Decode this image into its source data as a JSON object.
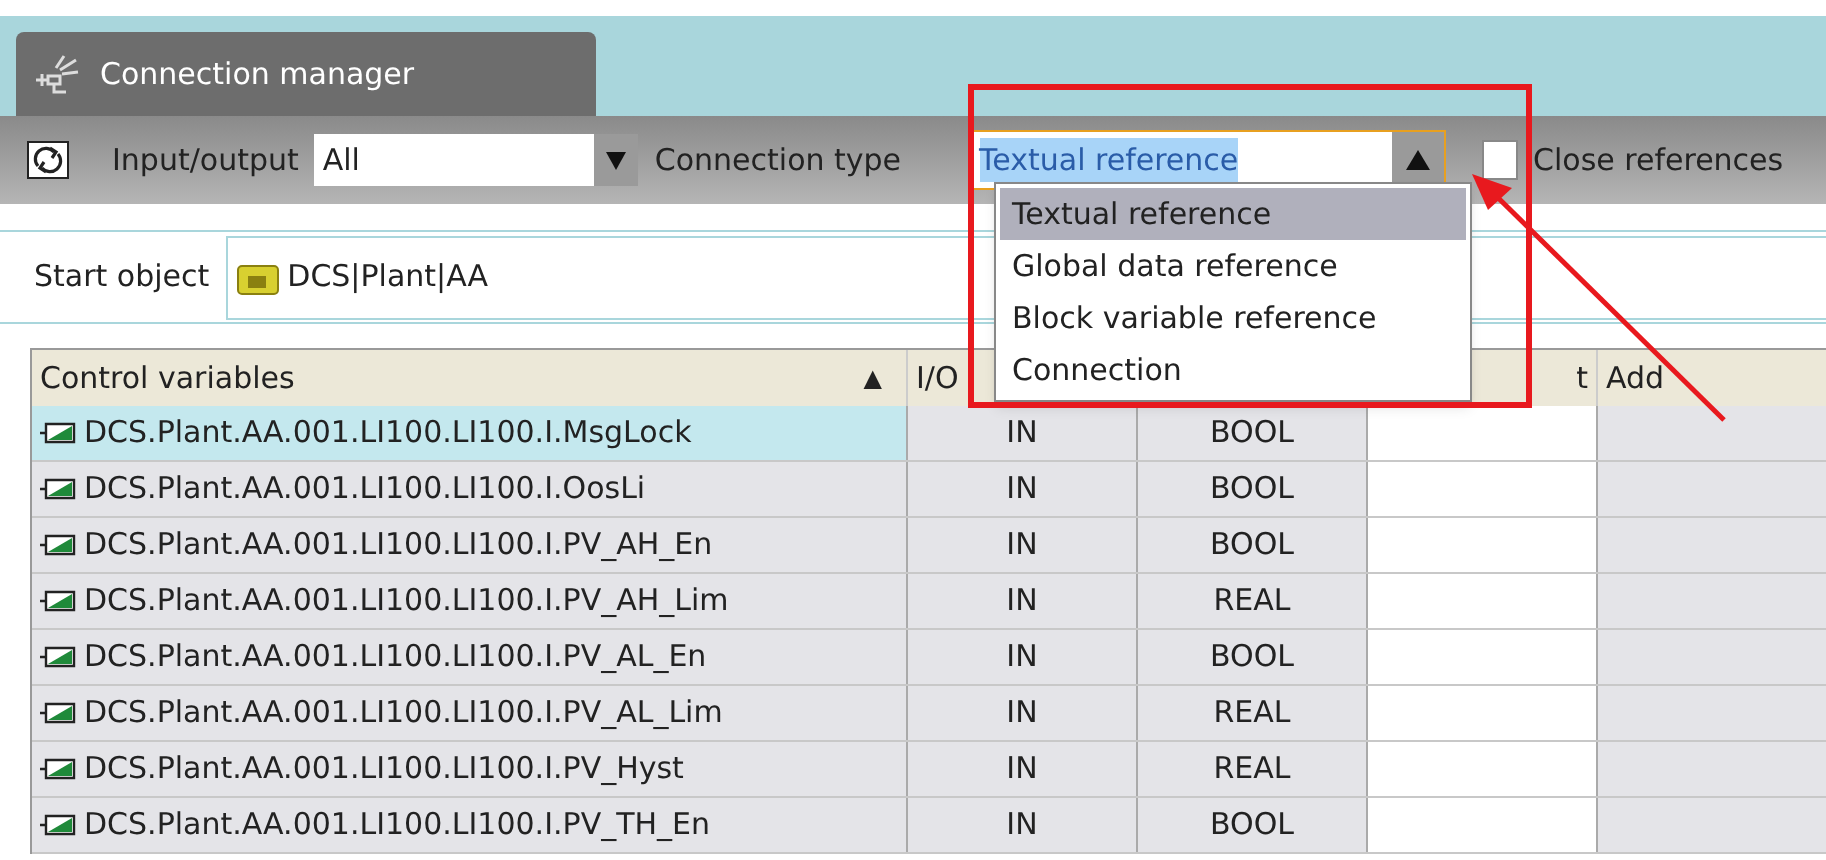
{
  "tab": {
    "title": "Connection manager",
    "selected": true
  },
  "toolbar": {
    "io_label": "Input/output",
    "io_value": "All",
    "type_label": "Connection type",
    "type_value": "Textual reference",
    "close_label": "Close references",
    "close_checked": false
  },
  "dropdown": {
    "options": [
      {
        "label": "Textual reference",
        "selected": true
      },
      {
        "label": "Global data reference",
        "selected": false
      },
      {
        "label": "Block variable reference",
        "selected": false
      },
      {
        "label": "Connection",
        "selected": false
      }
    ]
  },
  "start_object": {
    "label": "Start object",
    "value": "DCS|Plant|AA"
  },
  "table": {
    "columns": [
      "Control variables",
      "I/O",
      "t",
      "Add"
    ],
    "sort_icon": "▲",
    "rows": [
      {
        "name": "DCS.Plant.AA.001.LI100.LI100.I.MsgLock",
        "io": "IN",
        "type": "BOOL",
        "selected": true
      },
      {
        "name": "DCS.Plant.AA.001.LI100.LI100.I.OosLi",
        "io": "IN",
        "type": "BOOL",
        "selected": false
      },
      {
        "name": "DCS.Plant.AA.001.LI100.LI100.I.PV_AH_En",
        "io": "IN",
        "type": "BOOL",
        "selected": false
      },
      {
        "name": "DCS.Plant.AA.001.LI100.LI100.I.PV_AH_Lim",
        "io": "IN",
        "type": "REAL",
        "selected": false
      },
      {
        "name": "DCS.Plant.AA.001.LI100.LI100.I.PV_AL_En",
        "io": "IN",
        "type": "BOOL",
        "selected": false
      },
      {
        "name": "DCS.Plant.AA.001.LI100.LI100.I.PV_AL_Lim",
        "io": "IN",
        "type": "REAL",
        "selected": false
      },
      {
        "name": "DCS.Plant.AA.001.LI100.LI100.I.PV_Hyst",
        "io": "IN",
        "type": "REAL",
        "selected": false
      },
      {
        "name": "DCS.Plant.AA.001.LI100.LI100.I.PV_TH_En",
        "io": "IN",
        "type": "BOOL",
        "selected": false
      }
    ]
  }
}
